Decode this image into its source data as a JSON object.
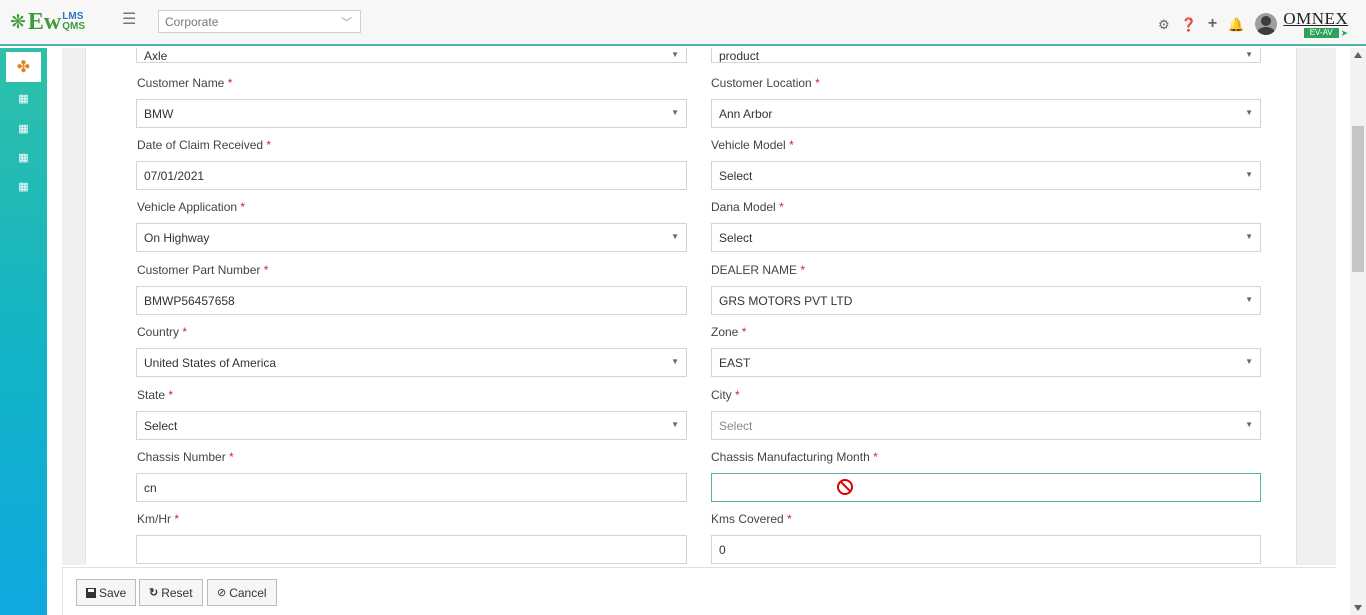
{
  "header": {
    "logo_ew": "Ew",
    "logo_lms": "LMS",
    "logo_qms": "QMS",
    "org_value": "Corporate",
    "brand_name": "OMNEX",
    "brand_tag": "EV-AV"
  },
  "icons": {
    "logo": "flower-icon",
    "menu": "hamburger-icon",
    "settings": "gear-icon",
    "help": "help-icon",
    "add": "plus-icon",
    "notifications": "bell-icon",
    "user": "avatar-icon",
    "sidebar_modules": [
      "grid-icon",
      "building-icon",
      "building-icon",
      "building-icon",
      "building-icon"
    ],
    "not_allowed": "no-symbol-icon"
  },
  "colors": {
    "accent": "#4fb3a8",
    "required": "#d9232d",
    "brand_green": "#3d9b3a",
    "sidebar_top": "#2ec0a8",
    "sidebar_bottom": "#10a8df"
  },
  "form": {
    "partial_left_value": "Axle",
    "partial_right_value": "product",
    "customer_name": {
      "label": "Customer Name",
      "value": "BMW"
    },
    "customer_location": {
      "label": "Customer Location",
      "value": "Ann Arbor"
    },
    "date_of_claim": {
      "label": "Date of Claim Received",
      "value": "07/01/2021"
    },
    "vehicle_model": {
      "label": "Vehicle Model",
      "value": "Select"
    },
    "vehicle_application": {
      "label": "Vehicle Application",
      "value": "On Highway"
    },
    "dana_model": {
      "label": "Dana Model",
      "value": "Select"
    },
    "customer_part_number": {
      "label": "Customer Part Number",
      "value": "BMWP56457658"
    },
    "dealer_name": {
      "label": "DEALER NAME",
      "value": "GRS MOTORS PVT LTD"
    },
    "country": {
      "label": "Country",
      "value": "United States of America"
    },
    "zone": {
      "label": "Zone",
      "value": "EAST"
    },
    "state": {
      "label": "State",
      "value": "Select"
    },
    "city": {
      "label": "City",
      "value": "Select"
    },
    "chassis_number": {
      "label": "Chassis Number",
      "value": "cn"
    },
    "chassis_mfg_month": {
      "label": "Chassis Manufacturing Month",
      "value": ""
    },
    "km_hr": {
      "label": "Km/Hr",
      "value": ""
    },
    "kms_covered": {
      "label": "Kms Covered",
      "value": "0"
    },
    "required_mark": "*"
  },
  "footer": {
    "save": "Save",
    "reset": "Reset",
    "cancel": "Cancel"
  }
}
